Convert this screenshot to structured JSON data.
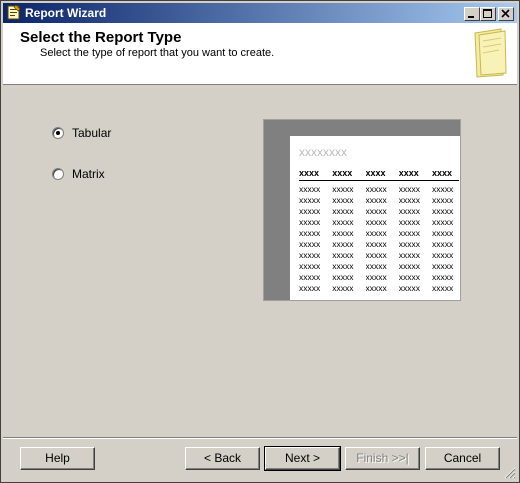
{
  "window": {
    "title": "Report Wizard"
  },
  "header": {
    "title": "Select the Report Type",
    "subtitle": "Select the type of report that you want to create."
  },
  "report_types": [
    {
      "label": "Tabular",
      "selected": true
    },
    {
      "label": "Matrix",
      "selected": false
    }
  ],
  "preview": {
    "title_placeholder": "xxxxxxxx",
    "header_cells": [
      "xxxx",
      "xxxx",
      "xxxx",
      "xxxx",
      "xxxx"
    ],
    "cell_text": "xxxxx",
    "row_count": 10
  },
  "buttons": {
    "help": "Help",
    "back": "< Back",
    "next": "Next >",
    "finish": "Finish >>|",
    "cancel": "Cancel"
  }
}
